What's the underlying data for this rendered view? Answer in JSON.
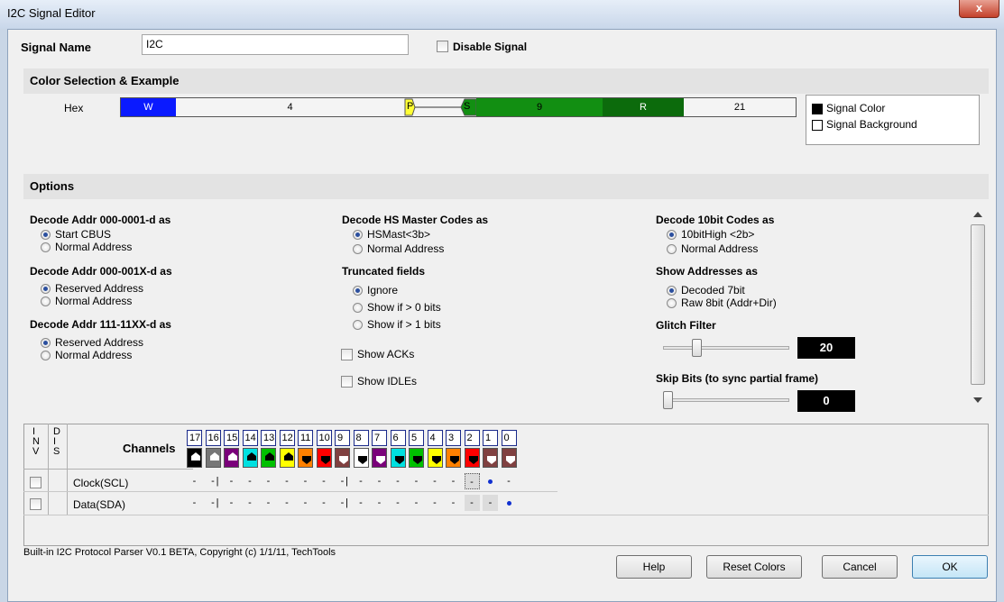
{
  "window": {
    "title": "I2C Signal Editor",
    "close": "x"
  },
  "signal": {
    "name_label": "Signal Name",
    "name_value": "I2C",
    "disable_label": "Disable  Signal"
  },
  "color_section": {
    "header": "Color Selection & Example",
    "hex_label": "Hex",
    "segments": {
      "w": "W",
      "four": "4",
      "p": "P",
      "s": "S",
      "nine": "9",
      "r": "R",
      "twentyone": "21"
    },
    "legend": {
      "signal_color": "Signal Color",
      "signal_background": "Signal Background"
    },
    "colors": {
      "blue": "#0a1aff",
      "green": "#128f12",
      "darkgreen": "#0c6b0c",
      "yellow": "#ffff33"
    }
  },
  "options": {
    "header": "Options",
    "decode_000_0001": {
      "title": "Decode Addr 000-0001-d as",
      "opt1": "Start CBUS",
      "opt2": "Normal Address"
    },
    "decode_000_001x": {
      "title": "Decode Addr 000-001X-d as",
      "opt1": "Reserved Address",
      "opt2": "Normal Address"
    },
    "decode_111_11xx": {
      "title": "Decode Addr 111-11XX-d as",
      "opt1": "Reserved Address",
      "opt2": "Normal Address"
    },
    "hs_master": {
      "title": "Decode HS Master Codes as",
      "opt1": "HSMast<3b>",
      "opt2": "Normal Address"
    },
    "truncated": {
      "title": "Truncated fields",
      "opt1": "Ignore",
      "opt2": "Show if > 0 bits",
      "opt3": "Show if > 1 bits"
    },
    "show_acks": "Show ACKs",
    "show_idles": "Show IDLEs",
    "tenbit": {
      "title": "Decode 10bit Codes as",
      "opt1": "10bitHigh <2b>",
      "opt2": "Normal Address"
    },
    "show_addr": {
      "title": "Show Addresses as",
      "opt1": "Decoded 7bit",
      "opt2": "Raw 8bit (Addr+Dir)"
    },
    "glitch": {
      "title": "Glitch Filter",
      "value": "20",
      "level": 0.25
    },
    "skip": {
      "title": "Skip Bits (to sync partial frame)",
      "value": "0",
      "level": 0
    }
  },
  "channels": {
    "inv_header": "I N V",
    "dis_header": "D I S",
    "header": "Channels",
    "numbers": [
      "17",
      "16",
      "15",
      "14",
      "13",
      "12",
      "11",
      "10",
      "9",
      "8",
      "7",
      "6",
      "5",
      "4",
      "3",
      "2",
      "1",
      "0"
    ],
    "swatch_colors": [
      "#000000",
      "#777777",
      "#7a007a",
      "#00e0e0",
      "#00c000",
      "#ffff00",
      "#ff8000",
      "#ff0000",
      "#804040",
      "#ffffff",
      "#7a007a",
      "#00e0e0",
      "#00c000",
      "#ffff00",
      "#ff8000",
      "#ff0000",
      "#804040",
      "#804040"
    ],
    "rows": [
      {
        "name": "Clock(SCL)"
      },
      {
        "name": "Data(SDA)"
      }
    ],
    "dash": "-",
    "pipe": "|"
  },
  "footer": {
    "copyright": "Built-in I2C Protocol Parser V0.1 BETA,  Copyright (c) 1/1/11, TechTools",
    "help": "Help",
    "reset": "Reset Colors",
    "cancel": "Cancel",
    "ok": "OK"
  }
}
